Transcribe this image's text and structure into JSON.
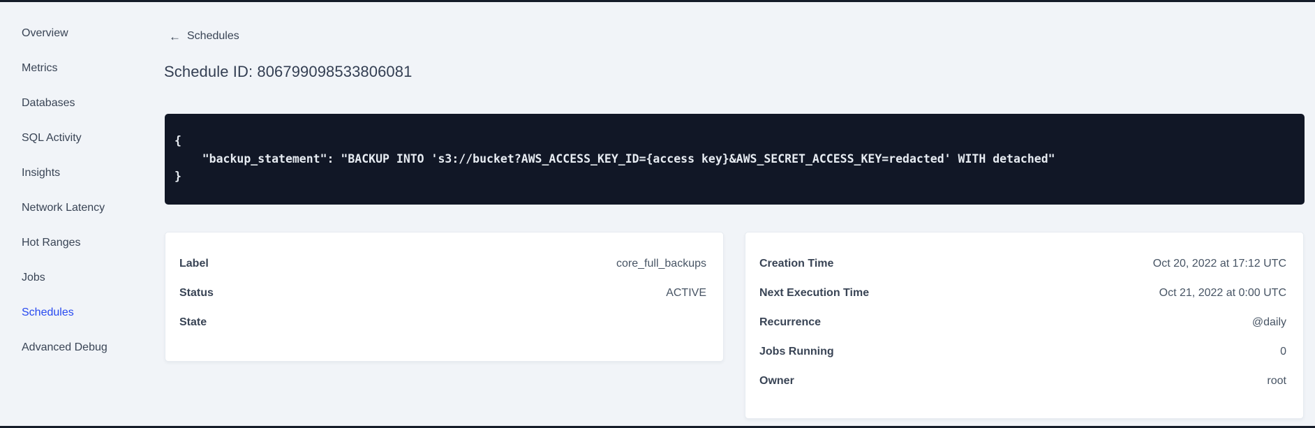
{
  "sidebar": {
    "items": [
      {
        "label": "Overview",
        "active": false
      },
      {
        "label": "Metrics",
        "active": false
      },
      {
        "label": "Databases",
        "active": false
      },
      {
        "label": "SQL Activity",
        "active": false
      },
      {
        "label": "Insights",
        "active": false
      },
      {
        "label": "Network Latency",
        "active": false
      },
      {
        "label": "Hot Ranges",
        "active": false
      },
      {
        "label": "Jobs",
        "active": false
      },
      {
        "label": "Schedules",
        "active": true
      },
      {
        "label": "Advanced Debug",
        "active": false
      }
    ]
  },
  "header": {
    "back_glyph": "←",
    "back_label": "Schedules",
    "title": "Schedule ID: 806799098533806081"
  },
  "code_block": {
    "text": "{\n    \"backup_statement\": \"BACKUP INTO 's3://bucket?AWS_ACCESS_KEY_ID={access key}&AWS_SECRET_ACCESS_KEY=redacted' WITH detached\"\n}"
  },
  "cards": {
    "left": {
      "rows": [
        {
          "label": "Label",
          "value": "core_full_backups"
        },
        {
          "label": "Status",
          "value": "ACTIVE"
        },
        {
          "label": "State",
          "value": ""
        }
      ]
    },
    "right": {
      "rows": [
        {
          "label": "Creation Time",
          "value": "Oct 20, 2022 at 17:12 UTC"
        },
        {
          "label": "Next Execution Time",
          "value": "Oct 21, 2022 at 0:00 UTC"
        },
        {
          "label": "Recurrence",
          "value": "@daily"
        },
        {
          "label": "Jobs Running",
          "value": "0"
        },
        {
          "label": "Owner",
          "value": "root"
        }
      ]
    }
  },
  "colors": {
    "page_bg": "#f1f4f8",
    "accent_active": "#2749f0",
    "code_bg": "#111726",
    "code_text": "#e7ecf2",
    "text_primary": "#394455",
    "edge_bar": "#151c29"
  }
}
